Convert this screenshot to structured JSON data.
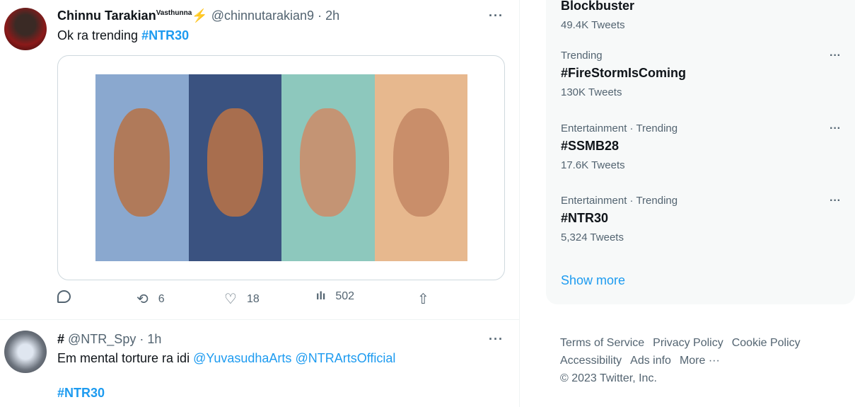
{
  "tweets": [
    {
      "name": "Chinnu Tarakian",
      "name_suffix": "Vasthunna",
      "emoji": "⚡",
      "handle": "@chinnutarakian9",
      "time": "2h",
      "text": "Ok ra trending ",
      "hashtag": "#NTR30",
      "replies": "",
      "retweets": "6",
      "likes": "18",
      "views": "502"
    },
    {
      "name": "#",
      "handle": "@NTR_Spy",
      "time": "1h",
      "text": "Em mental torture ra idi ",
      "mention1": "@YuvasudhaArts",
      "mention2": "@NTRArtsOfficial",
      "hashtag": "#NTR30"
    }
  ],
  "trends": [
    {
      "meta": "",
      "title": "Blockbuster",
      "count": "49.4K Tweets"
    },
    {
      "meta": "Trending",
      "title": "#FireStormIsComing",
      "count": "130K Tweets"
    },
    {
      "meta": "Entertainment · Trending",
      "title": "#SSMB28",
      "count": "17.6K Tweets"
    },
    {
      "meta": "Entertainment · Trending",
      "title": "#NTR30",
      "count": "5,324 Tweets"
    }
  ],
  "show_more": "Show more",
  "footer": {
    "links": [
      "Terms of Service",
      "Privacy Policy",
      "Cookie Policy",
      "Accessibility",
      "Ads info",
      "More ···"
    ],
    "copyright": "© 2023 Twitter, Inc."
  },
  "more_icon": "···",
  "colors": {
    "accent": "#1d9bf0",
    "muted": "#536471",
    "panel": "#f7f9f9"
  }
}
